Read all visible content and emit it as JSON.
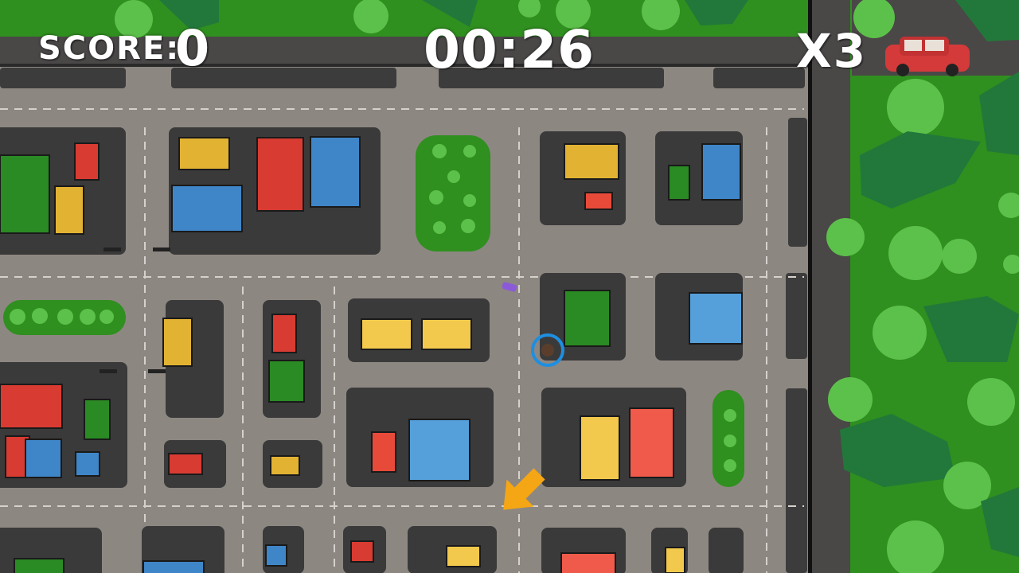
{
  "hud": {
    "score_label": "SCORE:",
    "score_value": "0",
    "timer": "00:26",
    "lives": "X3"
  },
  "scene": {
    "view": "top-down city map",
    "colors": {
      "grass": "#2f8f1f",
      "road": "#8f8984",
      "sidewalk_block": "#3b3a3a",
      "outer_road": "#4a4747",
      "building_red": "#d83b32",
      "building_blue": "#3f86c8",
      "building_yellow": "#e2b233",
      "building_green": "#2a8a24",
      "tree": "#5cc14a",
      "player_marker": "#1e8fe0",
      "direction_arrow": "#f5a614",
      "red_car": "#d43a3a"
    },
    "icons": [
      "player-marker-icon",
      "direction-arrow-icon",
      "red-car-icon"
    ]
  }
}
